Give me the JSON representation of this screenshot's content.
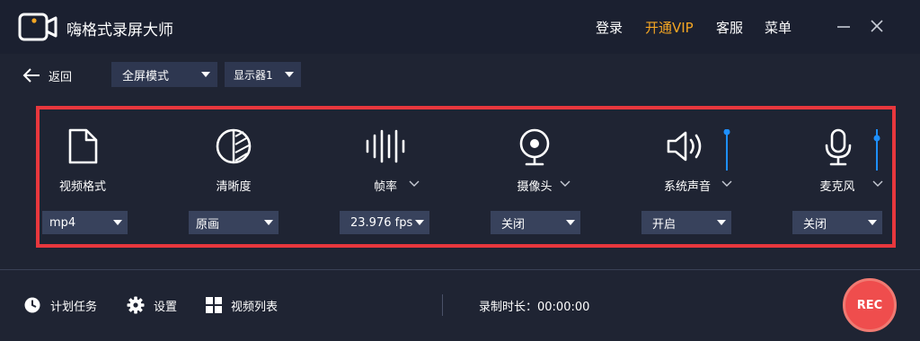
{
  "app": {
    "title": "嗨格式录屏大师",
    "brand_color": "#f5a623",
    "logo_icon": "video-camera-logo-icon"
  },
  "header": {
    "menu": [
      {
        "label": "登录"
      },
      {
        "label": "开通VIP"
      },
      {
        "label": "客服"
      },
      {
        "label": "菜单"
      }
    ],
    "window_icons": [
      "minimize-icon",
      "close-icon"
    ]
  },
  "toolbar": {
    "back_label": "返回",
    "mode_select": "全屏模式",
    "display_select": "显示器1"
  },
  "settings": [
    {
      "label": "视频格式",
      "icon": "file-icon",
      "value": "mp4"
    },
    {
      "label": "清晰度",
      "icon": "clarity-icon",
      "value": "原画"
    },
    {
      "label": "帧率",
      "icon": "framerate-icon",
      "value": "23.976 fps"
    },
    {
      "label": "摄像头",
      "icon": "webcam-icon",
      "value": "关闭"
    },
    {
      "label": "系统声音",
      "icon": "speaker-icon",
      "value": "开启"
    },
    {
      "label": "麦克风",
      "icon": "microphone-icon",
      "value": "关闭"
    }
  ],
  "bottom": {
    "schedule_label": "计划任务",
    "settings_label": "设置",
    "video_list_label": "视频列表",
    "duration_label": "录制时长：00:00:00",
    "rec_label": "REC"
  },
  "colors": {
    "background": "#1f2433",
    "highlight_border": "#e8373d",
    "slider_accent": "#1e90ff",
    "rec_button": "#ef4d4d"
  }
}
